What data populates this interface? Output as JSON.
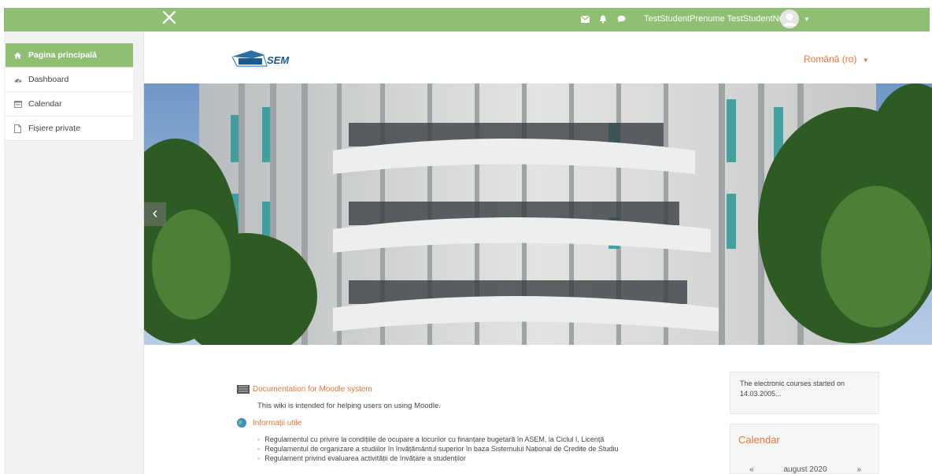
{
  "topbar": {
    "user_name": "TestStudentPrenume TestStudentNume",
    "color": "#8fbf73"
  },
  "icons": {
    "close": "close-icon",
    "messages": "envelope-icon",
    "notifications": "bell-icon",
    "chat": "chat-bubble-icon",
    "user_menu": "caret-down-icon"
  },
  "nav": {
    "items": [
      {
        "label": "Pagina principală",
        "icon": "home-icon",
        "active": true
      },
      {
        "label": "Dashboard",
        "icon": "dashboard-icon",
        "active": false
      },
      {
        "label": "Calendar",
        "icon": "calendar-icon",
        "active": false
      },
      {
        "label": "Fișiere private",
        "icon": "file-icon",
        "active": false
      }
    ]
  },
  "header": {
    "logo_text": "ASEM",
    "language": "Română (ro)"
  },
  "banner": {
    "prev_label": "‹"
  },
  "main": {
    "doc_link": "Documentation for Moodle system",
    "doc_desc": "This wiki is intended for helping users on using Moodle.",
    "info_link": "Informații utile",
    "info_list": [
      "Regulamentul cu privire la condițiile de ocupare a locurilor cu finanțare bugetară în ASEM, la Ciclul I, Licență",
      "Regulamentul de organizare a studiilor în învățământul superior în baza Sistemului Național de Credite de Studiu",
      "Regulament privind evaluarea activității de învățare a studenților"
    ]
  },
  "blocks": {
    "info_text": "The electronic courses started on 14.03.2005...",
    "calendar_title": "Calendar",
    "calendar_prev": "«",
    "calendar_month": "august 2020",
    "calendar_next": "»"
  },
  "colors": {
    "accent": "#8fbf73",
    "link": "#e8753b"
  }
}
